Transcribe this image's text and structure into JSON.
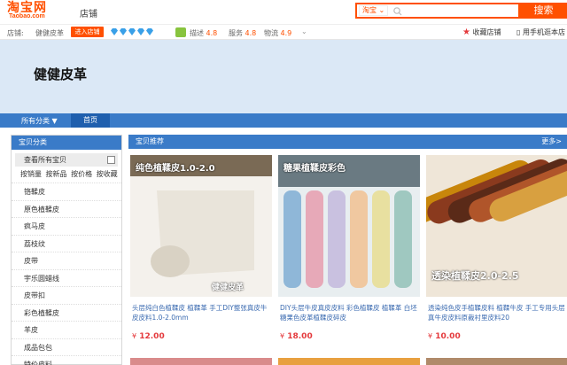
{
  "header": {
    "logo": "淘宝网",
    "logo_sub": "Taobao.com",
    "store_tab": "店铺",
    "search_scope": "淘宝",
    "search_placeholder": "",
    "search_button": "搜索"
  },
  "store_info": {
    "label": "店铺:",
    "name": "健健皮革",
    "enter_button": "进入店铺",
    "diamond_count": 5,
    "ratings": [
      {
        "label": "描述",
        "value": "4.8"
      },
      {
        "label": "服务",
        "value": "4.8"
      },
      {
        "label": "物流",
        "value": "4.9"
      }
    ],
    "favorite": "收藏店铺",
    "mobile": "用手机逛本店"
  },
  "banner": {
    "shop_title": "健健皮革"
  },
  "nav": {
    "category": "所有分类",
    "home": "首页"
  },
  "sidebar": {
    "title": "宝贝分类",
    "view_all": "查看所有宝贝",
    "sorts": [
      "按销量",
      "按新品",
      "按价格",
      "按收藏"
    ],
    "items": [
      "铬鞣皮",
      "原色植鞣皮",
      "疯马皮",
      "荔枝纹",
      "皮带",
      "宇乐圆蜡线",
      "皮带扣",
      "彩色植鞣皮",
      "羊皮",
      "成品包包",
      "特价皮料"
    ]
  },
  "main": {
    "title": "宝贝推荐",
    "more": "更多>",
    "products": [
      {
        "overlay": "纯色植鞣皮1.0-2.0",
        "brand": "健健皮革",
        "title": "头层纯白色植鞣皮 植鞣革 手工DIY整张真皮牛皮皮料1.0-2.0mm",
        "currency": "¥",
        "price": "12.00",
        "colors": [
          "#e9e4da",
          "#d9d2c4"
        ]
      },
      {
        "overlay": "糖果植鞣皮彩色",
        "brand": "",
        "title": "DIY头层牛皮真皮皮料 彩色植鞣皮 植鞣革 白坯糖果色皮革植鞣皮碎皮",
        "currency": "¥",
        "price": "18.00",
        "colors": [
          "#8fb7d8",
          "#e7a9b8",
          "#c9c1e0",
          "#f0c8a0",
          "#e8e0a0",
          "#9fc8c0"
        ]
      },
      {
        "overlay": "透染植鞣皮2.0-2.5",
        "brand": "",
        "title": "透染纯色皮手植鞣皮料 植鞣牛皮 手工专用头层真牛皮皮料原裁衬里皮料20",
        "currency": "¥",
        "price": "10.00",
        "colors": [
          "#c8860b",
          "#8a3a1e",
          "#5a2a18",
          "#b0552a",
          "#d8a040"
        ]
      }
    ]
  }
}
